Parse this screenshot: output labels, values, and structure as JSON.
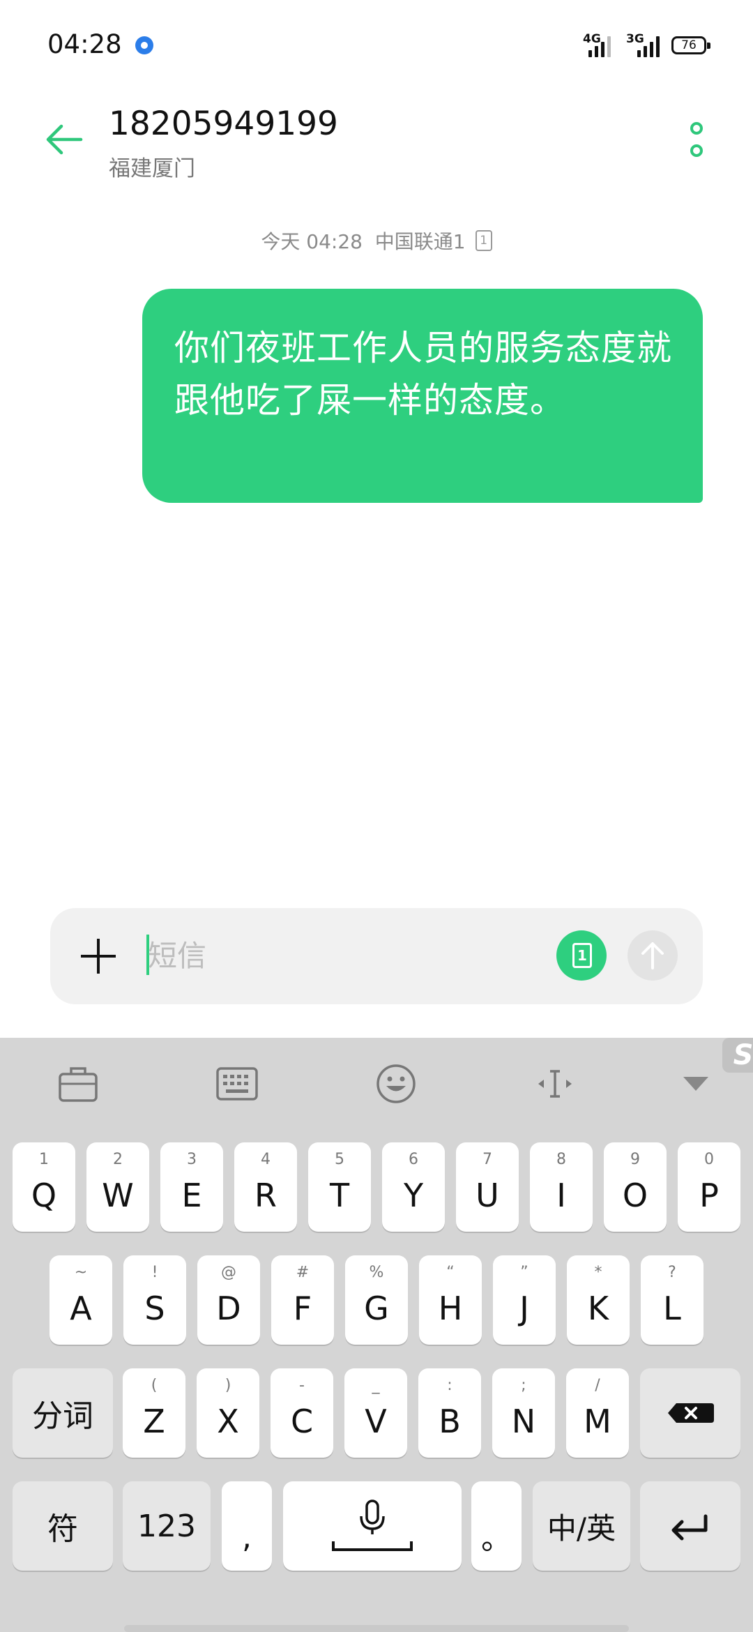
{
  "status_bar": {
    "time": "04:28",
    "network_1": "4G",
    "network_2": "3G",
    "battery": "76"
  },
  "header": {
    "contact_number": "18205949199",
    "contact_location": "福建厦门"
  },
  "conversation": {
    "timestamp": "今天 04:28",
    "carrier": "中国联通1",
    "sim_badge": "1",
    "messages": [
      {
        "direction": "outgoing",
        "text": "你们夜班工作人员的服务态度就跟他吃了屎一样的态度。"
      }
    ]
  },
  "composer": {
    "placeholder": "短信",
    "value": "",
    "sim_badge": "1"
  },
  "keyboard": {
    "corner_badge": "S",
    "row1": [
      {
        "hint": "1",
        "label": "Q"
      },
      {
        "hint": "2",
        "label": "W"
      },
      {
        "hint": "3",
        "label": "E"
      },
      {
        "hint": "4",
        "label": "R"
      },
      {
        "hint": "5",
        "label": "T"
      },
      {
        "hint": "6",
        "label": "Y"
      },
      {
        "hint": "7",
        "label": "U"
      },
      {
        "hint": "8",
        "label": "I"
      },
      {
        "hint": "9",
        "label": "O"
      },
      {
        "hint": "0",
        "label": "P"
      }
    ],
    "row2": [
      {
        "hint": "~",
        "label": "A"
      },
      {
        "hint": "!",
        "label": "S"
      },
      {
        "hint": "@",
        "label": "D"
      },
      {
        "hint": "#",
        "label": "F"
      },
      {
        "hint": "%",
        "label": "G"
      },
      {
        "hint": "“",
        "label": "H"
      },
      {
        "hint": "”",
        "label": "J"
      },
      {
        "hint": "*",
        "label": "K"
      },
      {
        "hint": "?",
        "label": "L"
      }
    ],
    "row3": [
      {
        "hint": "(",
        "label": "Z"
      },
      {
        "hint": ")",
        "label": "X"
      },
      {
        "hint": "-",
        "label": "C"
      },
      {
        "hint": "_",
        "label": "V"
      },
      {
        "hint": ":",
        "label": "B"
      },
      {
        "hint": ";",
        "label": "N"
      },
      {
        "hint": "/",
        "label": "M"
      }
    ],
    "segment_key": "分词",
    "symbol_key": "符",
    "number_key": "123",
    "comma_key": ",",
    "period_key": "。",
    "lang_key": "中/英"
  }
}
